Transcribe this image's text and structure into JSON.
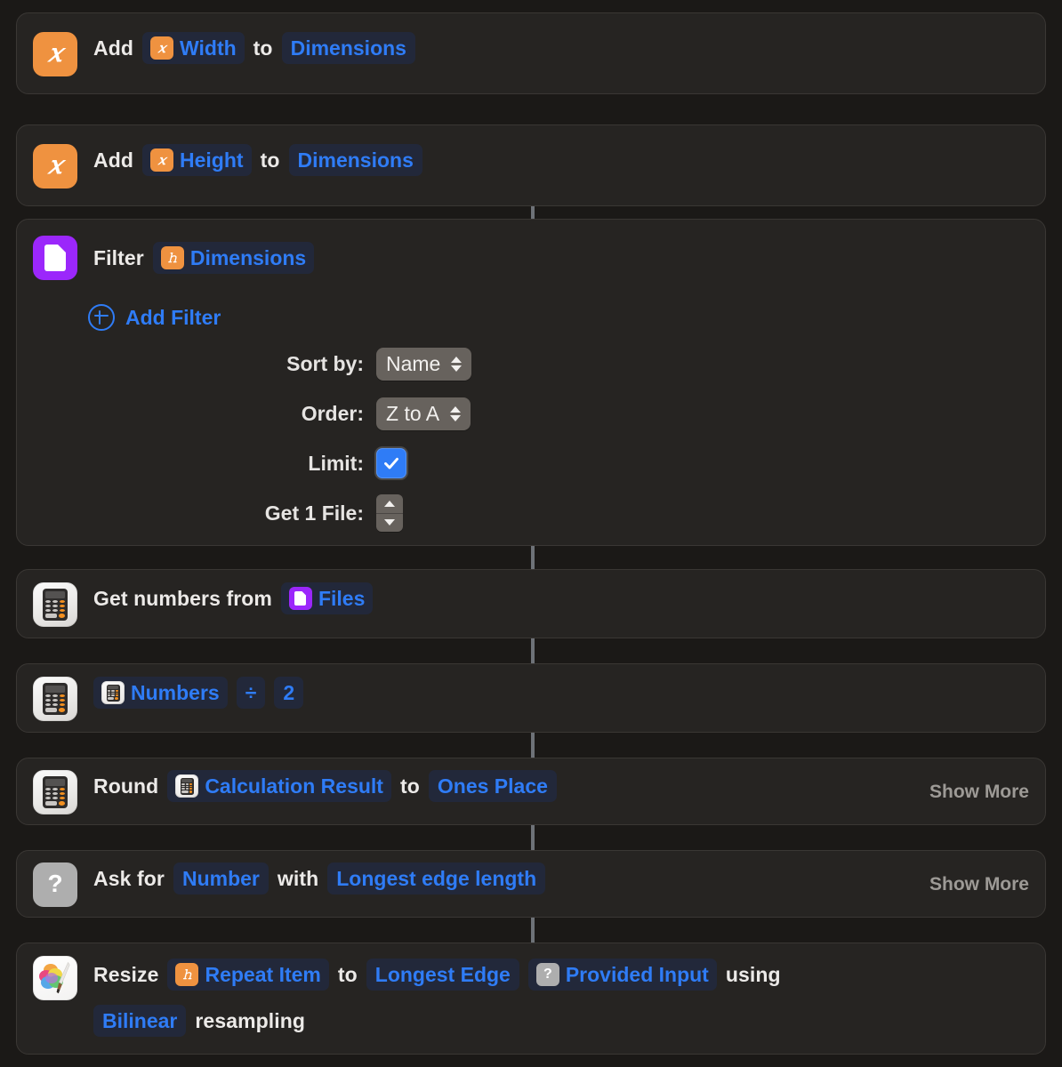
{
  "app": "Shortcuts",
  "theme": {
    "page_bg": "#1b1917",
    "card_bg": "#262422",
    "card_border": "#3a3734",
    "accent_blue": "#2f7cf6",
    "token_bg": "#22283a",
    "variable_orange": "#ef9240",
    "files_purple": "#9b27fb",
    "ask_gray": "#aeaeae",
    "popup_gray": "#67625d",
    "connector_gray": "#6e7278",
    "text_primary": "#eceae8",
    "text_muted": "#9d9a96"
  },
  "actions": [
    {
      "id": "add-width",
      "icon": "variable-icon",
      "icon_glyph": "𝑥",
      "words": {
        "w1": "Add",
        "w2": "to"
      },
      "tokens": {
        "t1": "Width",
        "t2": "Dimensions"
      }
    },
    {
      "id": "add-height",
      "icon": "variable-icon",
      "icon_glyph": "𝑥",
      "words": {
        "w1": "Add",
        "w2": "to"
      },
      "tokens": {
        "t1": "Height",
        "t2": "Dimensions"
      }
    },
    {
      "id": "filter-files",
      "icon": "files-icon",
      "words": {
        "w1": "Filter"
      },
      "tokens": {
        "t1": "Dimensions"
      },
      "add_filter_label": "Add Filter",
      "params": [
        {
          "label": "Sort by:",
          "control": "popup",
          "value": "Name"
        },
        {
          "label": "Order:",
          "control": "popup",
          "value": "Z to A"
        },
        {
          "label": "Limit:",
          "control": "checkbox",
          "value": "checked"
        },
        {
          "label": "Get 1 File:",
          "control": "stepper",
          "value": "1"
        }
      ]
    },
    {
      "id": "get-numbers-from-input",
      "icon": "calculator-icon",
      "words": {
        "w1": "Get numbers from"
      },
      "tokens": {
        "t1": "Files"
      }
    },
    {
      "id": "calculate",
      "icon": "calculator-icon",
      "tokens": {
        "t1": "Numbers",
        "op": "÷",
        "t2": "2"
      }
    },
    {
      "id": "round-number",
      "icon": "calculator-icon",
      "words": {
        "w1": "Round",
        "w2": "to"
      },
      "tokens": {
        "t1": "Calculation Result",
        "t2": "Ones Place"
      },
      "show_more": "Show More"
    },
    {
      "id": "ask-for-input",
      "icon": "ask-icon",
      "icon_glyph": "?",
      "words": {
        "w1": "Ask for",
        "w2": "with"
      },
      "tokens": {
        "t1": "Number",
        "t2": "Longest edge length"
      },
      "show_more": "Show More"
    },
    {
      "id": "resize-image",
      "icon": "pixelmator-icon",
      "words": {
        "w1": "Resize",
        "w2": "to",
        "w3": "using",
        "w4": "resampling"
      },
      "tokens": {
        "t1": "Repeat Item",
        "t2": "Longest Edge",
        "t3": "Provided Input",
        "t4": "Bilinear"
      }
    }
  ]
}
